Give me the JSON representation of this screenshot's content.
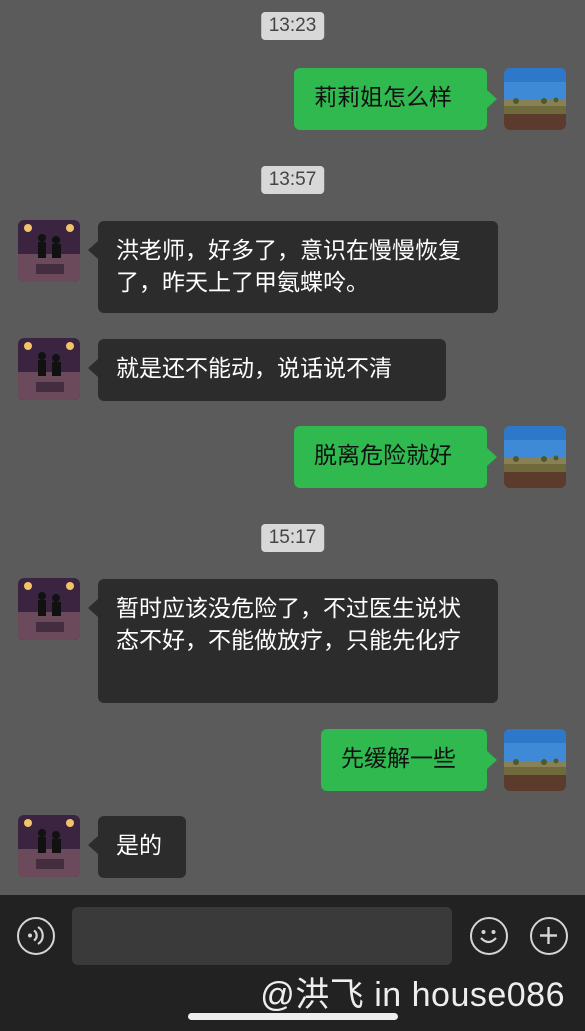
{
  "messages": {
    "t1": "13:23",
    "m1": "莉莉姐怎么样",
    "t2": "13:57",
    "m2": "洪老师，好多了，意识在慢慢恢复了，昨天上了甲氨蝶呤。",
    "m3": "就是还不能动，说话说不清",
    "m4": "脱离危险就好",
    "t3": "15:17",
    "m5": "暂时应该没危险了，不过医生说状态不好，不能做放疗，只能先化疗",
    "m6": "先缓解一些",
    "m7": "是的"
  },
  "icons": {
    "voice": "voice-icon",
    "emoji": "emoji-icon",
    "plus": "plus-icon"
  },
  "watermark": "@洪飞 in house086",
  "colors": {
    "background": "#5b5b5b",
    "incoming_bubble": "#2c2c2c",
    "outgoing_bubble": "#2fb94f",
    "bottom_bar": "#222222"
  }
}
